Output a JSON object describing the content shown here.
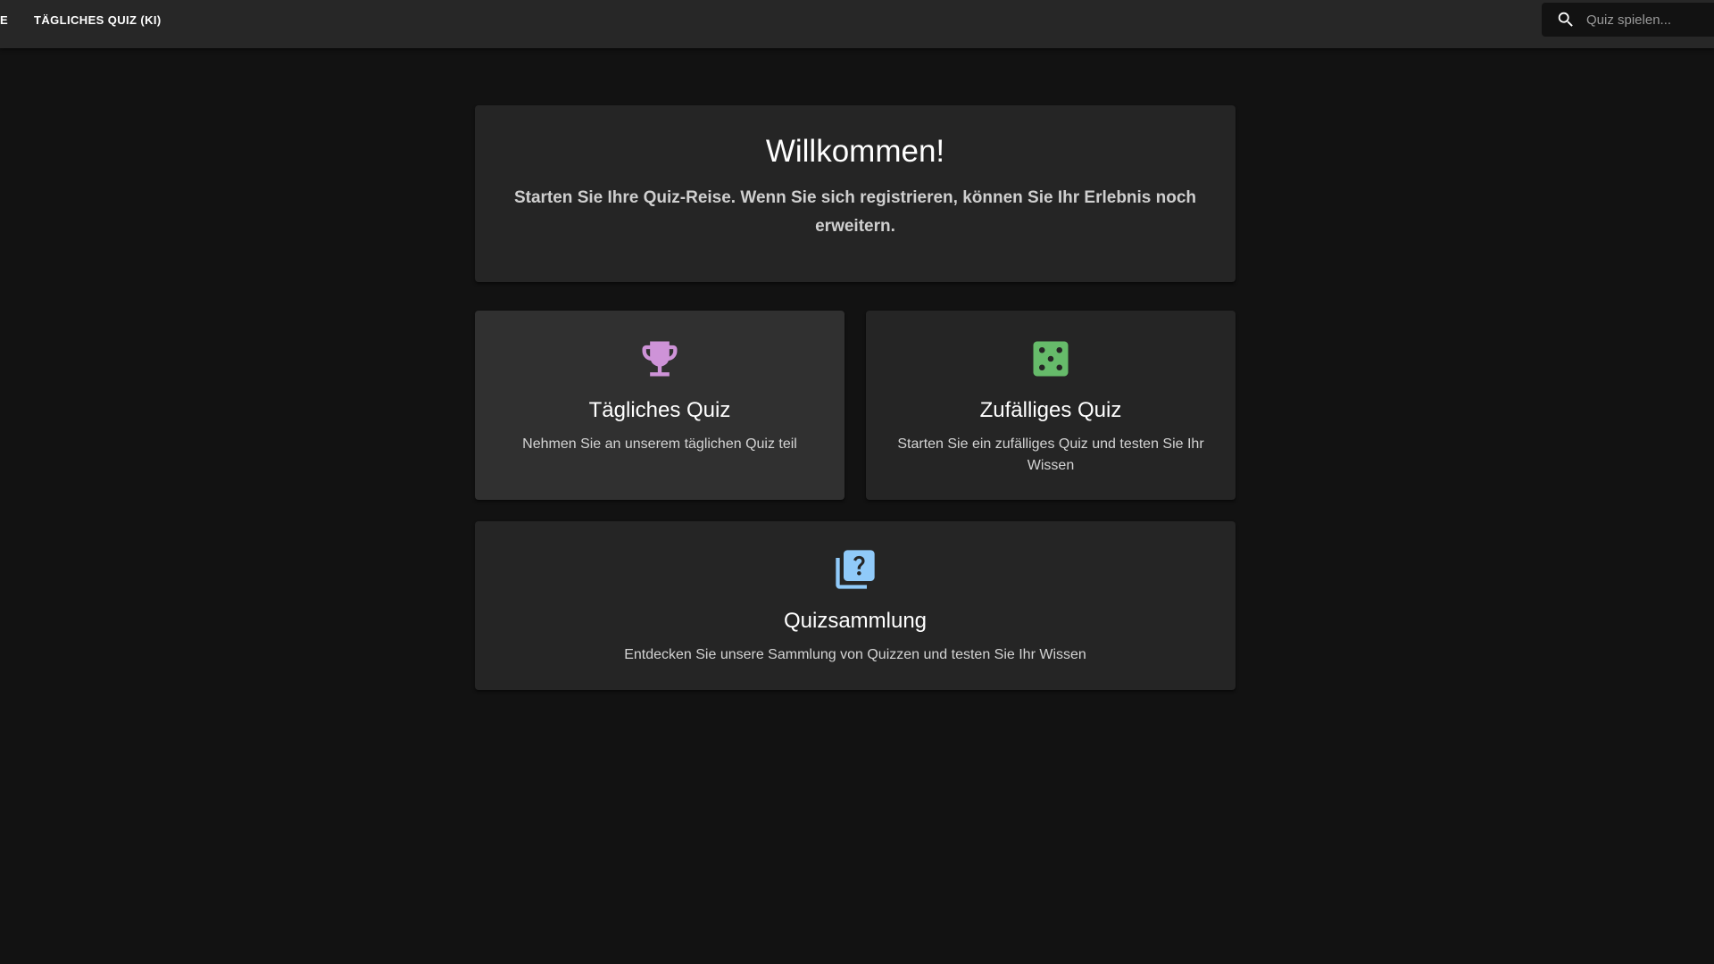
{
  "nav": {
    "partial_label": "E",
    "daily_label": "Tägliches Quiz (KI)"
  },
  "search": {
    "placeholder": "Quiz spielen..."
  },
  "welcome": {
    "title": "Willkommen!",
    "subtitle": "Starten Sie Ihre Quiz-Reise. Wenn Sie sich registrieren, können Sie Ihr Erlebnis noch erweitern."
  },
  "cards": [
    {
      "icon": "trophy-icon",
      "icon_color": "#ce93d8",
      "title": "Tägliches Quiz",
      "description": "Nehmen Sie an unserem täglichen Quiz teil"
    },
    {
      "icon": "dice-icon",
      "icon_color": "#66bb6a",
      "title": "Zufälliges Quiz",
      "description": "Starten Sie ein zufälliges Quiz und testen Sie Ihr Wissen"
    },
    {
      "icon": "quiz-collection-icon",
      "icon_color": "#90caf9",
      "title": "Quizsammlung",
      "description": "Entdecken Sie unsere Sammlung von Quizzen und testen Sie Ihr Wissen"
    }
  ],
  "colors": {
    "background": "#121212",
    "appbar": "#272727",
    "card": "#252525"
  }
}
